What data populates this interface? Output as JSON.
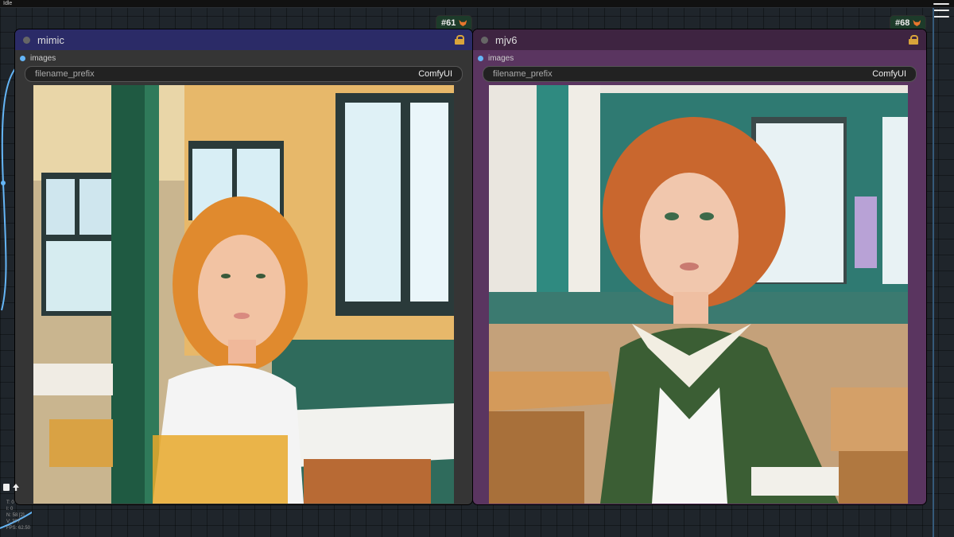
{
  "status": "Idle",
  "nodes": [
    {
      "id_badge": "#61",
      "title": "mimic",
      "output_label": "images",
      "widget_label": "filename_prefix",
      "widget_value": "ComfyUI",
      "header_color": "#2b2b67",
      "body_color": "#353535",
      "image_desc": "girl-classroom-window"
    },
    {
      "id_badge": "#68",
      "title": "mjv6",
      "output_label": "images",
      "widget_label": "filename_prefix",
      "widget_value": "ComfyUI",
      "header_color": "#3e2441",
      "body_color": "#5a3560",
      "image_desc": "girl-classroom-desks"
    }
  ],
  "stats": [
    "T: 0",
    "I: 0",
    "N: 58 [2]",
    "V: 2??",
    "FPS: 62.50"
  ]
}
